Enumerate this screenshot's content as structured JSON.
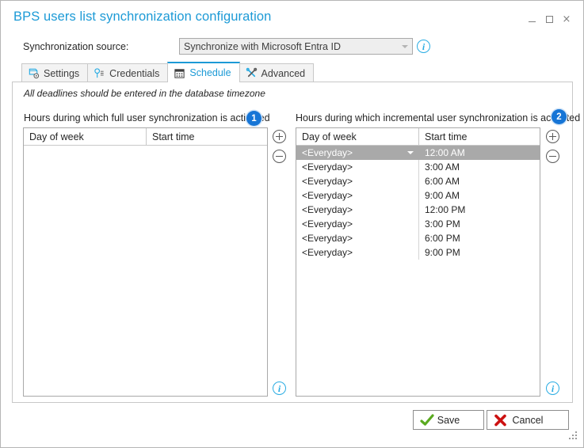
{
  "window": {
    "title": "BPS users list synchronization configuration",
    "minimize_label": "",
    "maximize_label": "",
    "close_label": "×"
  },
  "source": {
    "label": "Synchronization source:",
    "value": "Synchronize with Microsoft Entra ID",
    "info_glyph": "i"
  },
  "tabs": [
    {
      "label": "Settings",
      "icon": "settings-icon",
      "active": false
    },
    {
      "label": "Credentials",
      "icon": "key-icon",
      "active": false
    },
    {
      "label": "Schedule",
      "icon": "calendar-icon",
      "active": true
    },
    {
      "label": "Advanced",
      "icon": "tools-icon",
      "active": false
    }
  ],
  "schedule": {
    "note": "All deadlines should be entered in the database timezone",
    "full": {
      "caption": "Hours during which full user synchronization is activated",
      "badge": "1",
      "columns": [
        "Day of week",
        "Start time"
      ],
      "rows": [],
      "add_label": "+",
      "remove_label": "−",
      "info_glyph": "i"
    },
    "incremental": {
      "caption": "Hours during which incremental user synchronization is activated",
      "badge": "2",
      "columns": [
        "Day of week",
        "Start time"
      ],
      "rows": [
        {
          "day": "<Everyday>",
          "time": "12:00 AM",
          "selected": true
        },
        {
          "day": "<Everyday>",
          "time": "3:00 AM",
          "selected": false
        },
        {
          "day": "<Everyday>",
          "time": "6:00 AM",
          "selected": false
        },
        {
          "day": "<Everyday>",
          "time": "9:00 AM",
          "selected": false
        },
        {
          "day": "<Everyday>",
          "time": "12:00 PM",
          "selected": false
        },
        {
          "day": "<Everyday>",
          "time": "3:00 PM",
          "selected": false
        },
        {
          "day": "<Everyday>",
          "time": "6:00 PM",
          "selected": false
        },
        {
          "day": "<Everyday>",
          "time": "9:00 PM",
          "selected": false
        }
      ],
      "add_label": "+",
      "remove_label": "−",
      "info_glyph": "i"
    }
  },
  "footer": {
    "save_label": "Save",
    "cancel_label": "Cancel"
  },
  "colors": {
    "accent": "#1c9ad6",
    "badge": "#1675d6",
    "info": "#29ace3",
    "selection": "#a9a9a9",
    "save_check": "#5aaa20",
    "cancel_x": "#cc1111"
  }
}
